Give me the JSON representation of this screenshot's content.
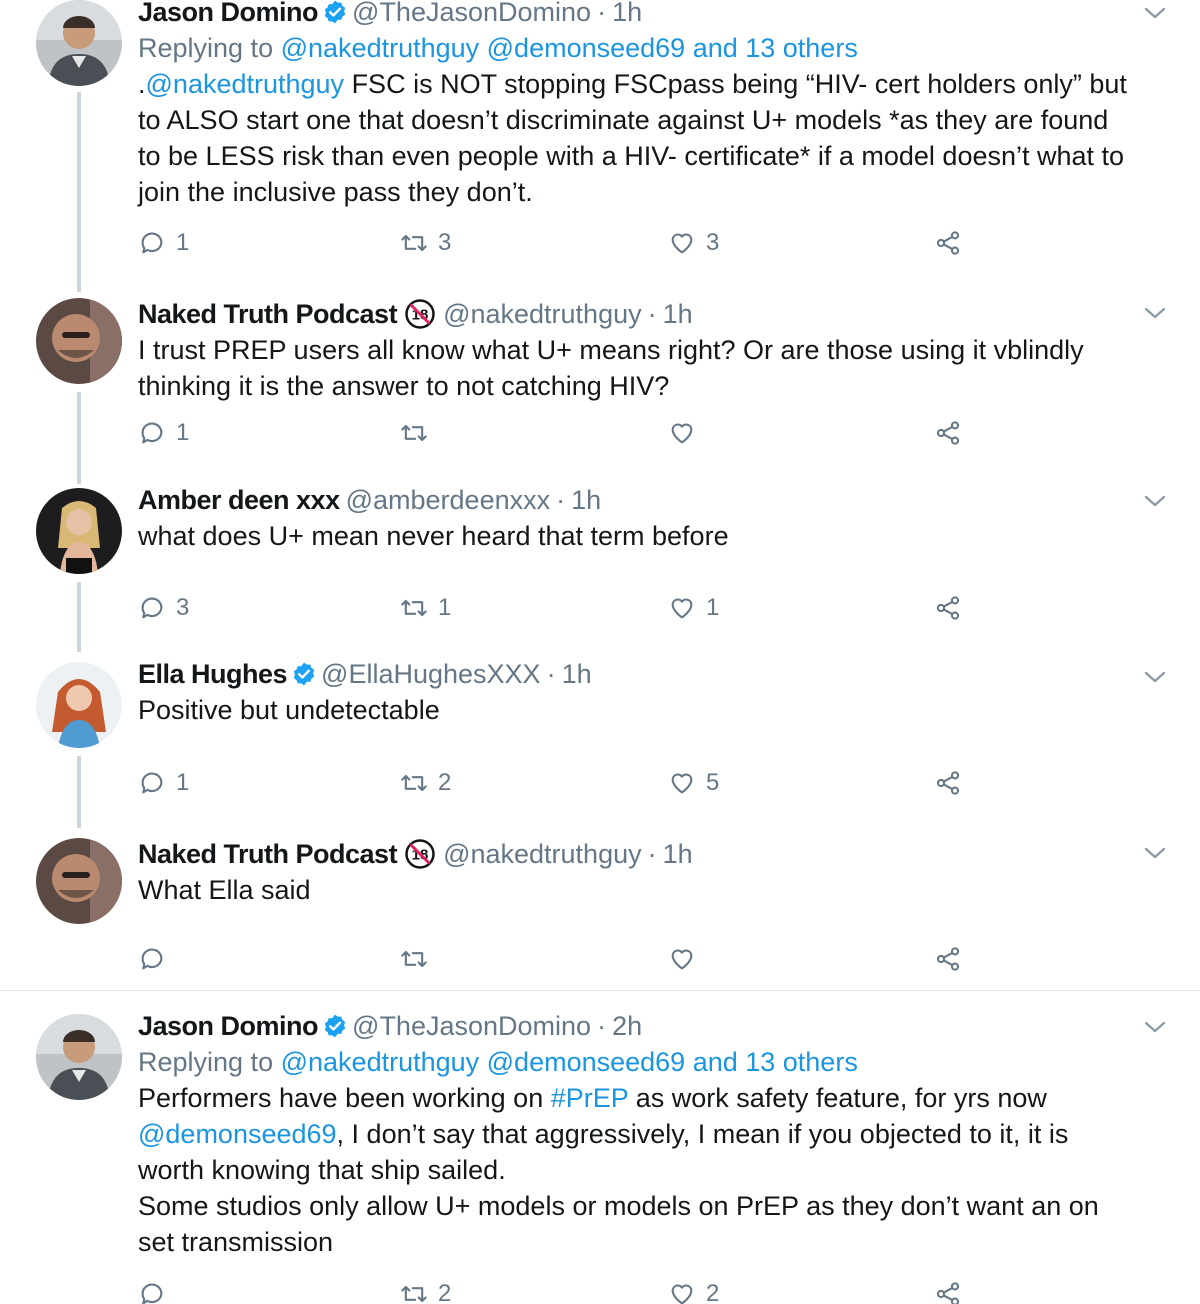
{
  "tweets": [
    {
      "name": "Jason Domino",
      "verified": true,
      "handle": "@TheJasonDomino",
      "time": "1h",
      "replying_prefix": "Replying to",
      "replying_to": "@nakedtruthguy @demonseed69 and 13 others",
      "text_segments": [
        [
          {
            "t": ".",
            "link": false
          },
          {
            "t": "@nakedtruthguy",
            "link": true
          },
          {
            "t": " FSC is NOT stopping FSCpass being “HIV- cert holders only” but",
            "link": false
          }
        ],
        [
          {
            "t": "to ALSO start one that doesn’t discriminate against U+ models *as they are found",
            "link": false
          }
        ],
        [
          {
            "t": "to be LESS risk than even people with a HIV- certificate* if a model doesn’t what to",
            "link": false
          }
        ],
        [
          {
            "t": "join the inclusive pass they don’t.",
            "link": false
          }
        ]
      ],
      "reply_count": "1",
      "retweet_count": "3",
      "like_count": "3"
    },
    {
      "name": "Naked Truth Podcast",
      "badge": "18",
      "handle": "@nakedtruthguy",
      "time": "1h",
      "text_segments": [
        [
          {
            "t": "I trust PREP users all know what U+ means right? Or are those using it vblindly",
            "link": false
          }
        ],
        [
          {
            "t": "thinking it is the answer to not catching HIV?",
            "link": false
          }
        ]
      ],
      "reply_count": "1",
      "retweet_count": "",
      "like_count": ""
    },
    {
      "name": "Amber deen xxx",
      "handle": "@amberdeenxxx",
      "time": "1h",
      "text_segments": [
        [
          {
            "t": "what does U+ mean never heard that term before",
            "link": false
          }
        ]
      ],
      "reply_count": "3",
      "retweet_count": "1",
      "like_count": "1"
    },
    {
      "name": "Ella Hughes",
      "verified": true,
      "handle": "@EllaHughesXXX",
      "time": "1h",
      "text_segments": [
        [
          {
            "t": "Positive but undetectable",
            "link": false
          }
        ]
      ],
      "reply_count": "1",
      "retweet_count": "2",
      "like_count": "5"
    },
    {
      "name": "Naked Truth Podcast",
      "badge": "18",
      "handle": "@nakedtruthguy",
      "time": "1h",
      "text_segments": [
        [
          {
            "t": "What Ella said",
            "link": false
          }
        ]
      ],
      "reply_count": "",
      "retweet_count": "",
      "like_count": ""
    },
    {
      "name": "Jason Domino",
      "verified": true,
      "handle": "@TheJasonDomino",
      "time": "2h",
      "replying_prefix": "Replying to",
      "replying_to": "@nakedtruthguy @demonseed69 and 13 others",
      "text_segments": [
        [
          {
            "t": "Performers have been working on ",
            "link": false
          },
          {
            "t": "#PrEP",
            "link": true
          },
          {
            "t": " as work safety feature, for yrs now",
            "link": false
          }
        ],
        [
          {
            "t": "@demonseed69",
            "link": true
          },
          {
            "t": ", I don’t say that aggressively, I mean if you objected to it, it is",
            "link": false
          }
        ],
        [
          {
            "t": "worth knowing that ship sailed.",
            "link": false
          }
        ],
        [
          {
            "t": "Some studios only allow U+ models or models on PrEP as they don’t want an on",
            "link": false
          }
        ],
        [
          {
            "t": "set transmission",
            "link": false
          }
        ]
      ],
      "reply_count": "",
      "retweet_count": "2",
      "like_count": "2"
    }
  ],
  "colors": {
    "link": "#1b95e0",
    "muted": "#657786",
    "text": "#14171a",
    "thread_line": "#ccd6dd",
    "verified": "#1da1f2"
  },
  "icons": [
    "reply-icon",
    "retweet-icon",
    "like-icon",
    "share-icon",
    "verified-badge-icon",
    "age-18-badge-icon",
    "chevron-down-icon"
  ]
}
